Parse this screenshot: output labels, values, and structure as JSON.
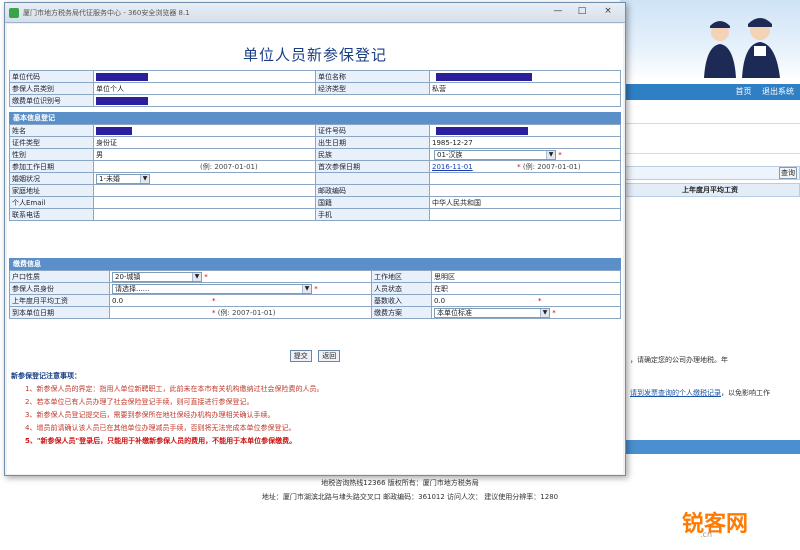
{
  "window": {
    "title": "厦门市地方税务局代征服务中心 - 360安全浏览器 8.1",
    "controls": [
      "—",
      "□",
      "×"
    ]
  },
  "form": {
    "title": "单位人员新参保登记",
    "unit_info": {
      "unit_code_label": "单位代码",
      "unit_name_label": "单位名称",
      "category_label": "参保人员类别",
      "category_value": "单位个人",
      "economy_label": "经济类型",
      "economy_value": "私营",
      "social_code_label": "缴费单位识别号"
    },
    "section_personal": "基本信息登记",
    "personal": {
      "name_label": "姓名",
      "id_label": "证件号码",
      "id_type_label": "证件类型",
      "id_type_value": "身份证",
      "birth_label": "出生日期",
      "birth_value": "1985-12-27",
      "gender_label": "性别",
      "gender_value": "男",
      "nation_label": "民族",
      "nation_value": "01-汉族",
      "work_date_label": "参加工作日期",
      "work_date_hint": "(例: 2007-01-01)",
      "first_insured_label": "首次参保日期",
      "first_insured_value": "2016-11-01",
      "first_insured_hint": "(例: 2007-01-01)",
      "marital_label": "婚姻状况",
      "marital_value": "1-未婚",
      "address_label": "家庭地址",
      "postcode_label": "邮政编码",
      "email_label": "个人Email",
      "country_label": "国籍",
      "country_value": "中华人民共和国",
      "phone_label": "联系电话",
      "mobile_label": "手机"
    },
    "section_insurance": "缴费信息",
    "insurance": {
      "hukou_label": "户口性质",
      "hukou_value": "20-城镇",
      "work_area_label": "工作地区",
      "work_area_value": "思明区",
      "status_label": "参保人员身份",
      "status_value": "请选择......",
      "employment_label": "人员状态",
      "employment_value": "在职",
      "wage_label": "上年度月平均工资",
      "wage_value": "0.0",
      "base_label": "基数收入",
      "base_value": "0.0",
      "start_date_label": "到本单位日期",
      "start_date_hint": "(例: 2007-01-01)",
      "fee_type_label": "缴费方案",
      "fee_type_value": "本单位标准"
    },
    "buttons": {
      "submit": "提交",
      "back": "返回"
    },
    "notes_title": "新参保登记注意事项：",
    "notes": [
      "1、新参保人员的界定：指用人单位新聘职工，此前未在本市有关机构缴纳过社会保险费的人员。",
      "2、若本单位已有人员办理了社会保险登记手续，则可直接进行参保登记。",
      "3、新参保人员登记提交后，需要到参保所在地社保经办机构办理相关确认手续。",
      "4、增员前请确认该人员已在其他单位办理减员手续，否则将无法完成本单位参保登记。",
      "5、\"新参保人员\"登录后，只能用于补缴新参保人员的费用，不能用于本单位参保缴费。"
    ]
  },
  "background": {
    "nav_links": [
      "首页",
      "退出系统"
    ],
    "query_button": "查询",
    "table_header": "上年度月平均工资",
    "text1": "，请确定您的公司办理地税。年",
    "text2": "请到发票查询的个人缴税记录",
    "text2_extra": "，以免影响工作",
    "footer_line1": "地税咨询热线12366  版权所有：厦门市地方税务局",
    "footer_line2": "地址：厦门市湖滨北路与埭头路交叉口  邮政编码：361012  访问人次：    建议使用分辨率：1280",
    "watermark": "锐客网",
    "watermark_sub": ".cn"
  }
}
